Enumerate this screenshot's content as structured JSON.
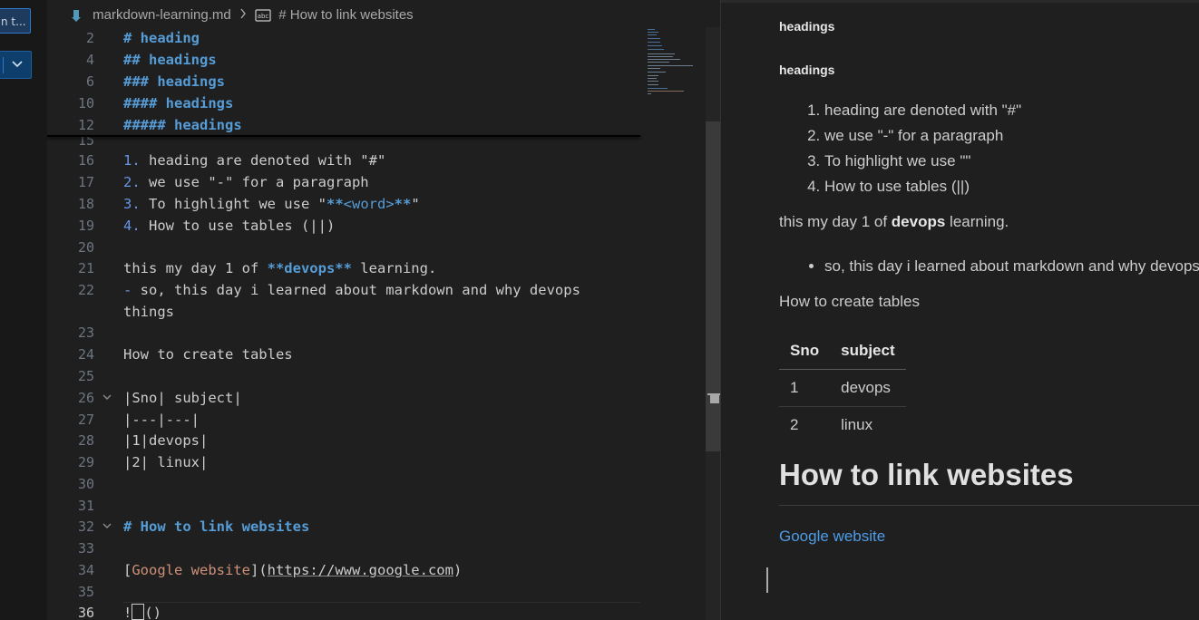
{
  "left_panel": {
    "input_text": "n t..."
  },
  "breadcrumb": {
    "file": "markdown-learning.md",
    "symbol": "# How to link websites"
  },
  "editor": {
    "sticky_lines": [
      {
        "n": "2",
        "text": "# heading"
      },
      {
        "n": "4",
        "text": "## headings"
      },
      {
        "n": "6",
        "text": "### headings"
      },
      {
        "n": "10",
        "text": "#### headings"
      },
      {
        "n": "12",
        "text": "##### headings"
      }
    ],
    "lines": {
      "l15": {
        "n": "15"
      },
      "l16": {
        "n": "16",
        "num": "1.",
        "text": " heading are denoted with \"#\""
      },
      "l17": {
        "n": "17",
        "num": "2.",
        "text": " we use \"-\" for a paragraph"
      },
      "l18": {
        "n": "18",
        "num": "3.",
        "a": " To highlight we use \"",
        "b": "**",
        "c": "<word>",
        "d": "**",
        "e": "\""
      },
      "l19": {
        "n": "19",
        "num": "4.",
        "text": " How to use tables (||)"
      },
      "l20": {
        "n": "20"
      },
      "l21": {
        "n": "21",
        "a": "this my day 1 of ",
        "b": "**devops**",
        "c": " learning."
      },
      "l22": {
        "n": "22",
        "a": "- ",
        "b": "so, this day i learned about markdown and why devops",
        "c": "things"
      },
      "l23": {
        "n": "23"
      },
      "l24": {
        "n": "24",
        "text": "How to create tables"
      },
      "l25": {
        "n": "25"
      },
      "l26": {
        "n": "26",
        "text": "|Sno| subject|"
      },
      "l27": {
        "n": "27",
        "text": "|---|---|"
      },
      "l28": {
        "n": "28",
        "text": "|1|devops|"
      },
      "l29": {
        "n": "29",
        "text": "|2| linux|"
      },
      "l30": {
        "n": "30"
      },
      "l31": {
        "n": "31"
      },
      "l32": {
        "n": "32",
        "text": "# How to link websites"
      },
      "l33": {
        "n": "33"
      },
      "l34": {
        "n": "34",
        "a": "[",
        "b": "Google website",
        "c": "](",
        "d": "https://www.google.com",
        "e": ")"
      },
      "l35": {
        "n": "35"
      },
      "l36": {
        "n": "36",
        "a": "!",
        "c": "()"
      }
    }
  },
  "preview": {
    "h6_1": "headings",
    "h6_2": "headings",
    "ol": [
      "heading are denoted with \"#\"",
      "we use \"-\" for a paragraph",
      "To highlight we use \"\"",
      "How to use tables (||)"
    ],
    "para": {
      "a": "this my day 1 of ",
      "bold": "devops",
      "c": " learning."
    },
    "bullet": "so, this day i learned about markdown and why devops things",
    "tables_heading": "How to create tables",
    "table": {
      "headers": [
        "Sno",
        "subject"
      ],
      "rows": [
        [
          "1",
          "devops"
        ],
        [
          "2",
          "linux"
        ]
      ]
    },
    "h1": "How to link websites",
    "link": "Google website"
  },
  "colors": {
    "background": "#1f1f1f",
    "heading": "#569cd6",
    "link_text": "#ce9178",
    "preview_link": "#4d9ce8",
    "accent": "#2b79d0"
  }
}
